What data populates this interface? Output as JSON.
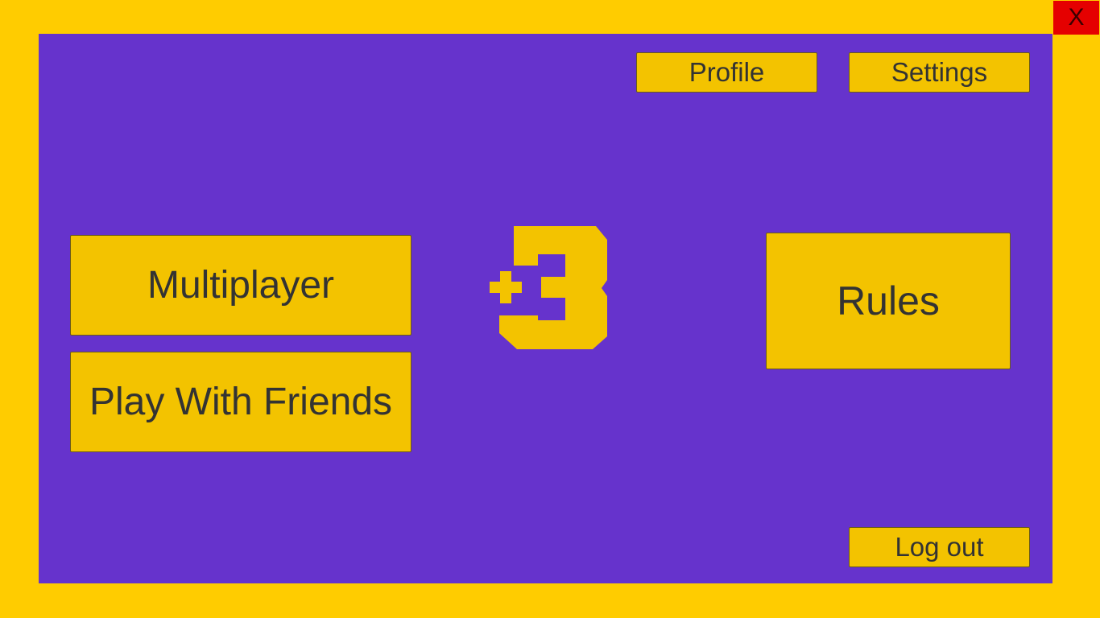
{
  "window": {
    "close_label": "X"
  },
  "menu": {
    "profile_label": "Profile",
    "settings_label": "Settings",
    "multiplayer_label": "Multiplayer",
    "play_with_friends_label": "Play With Friends",
    "rules_label": "Rules",
    "logout_label": "Log out"
  },
  "logo": {
    "icon": "plus-three-logo-icon",
    "color": "#f3c300"
  },
  "colors": {
    "frame": "#ffcc00",
    "panel": "#6633cc",
    "button": "#f3c300",
    "button_text": "#333333",
    "close_button": "#e50000"
  }
}
